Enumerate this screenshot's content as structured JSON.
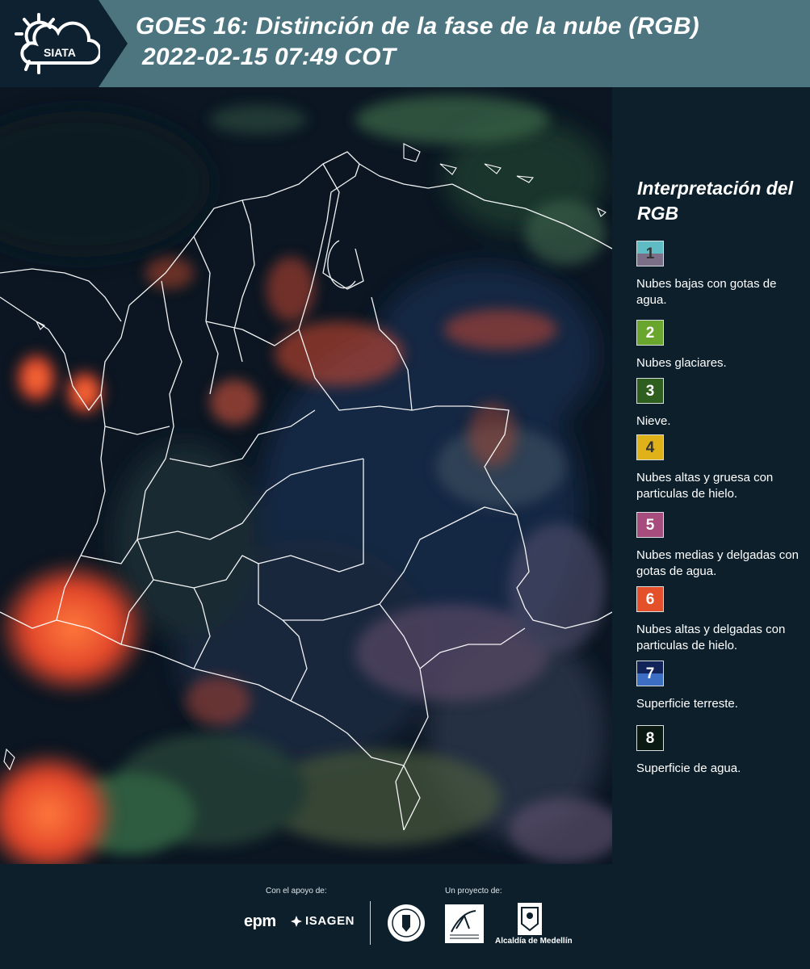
{
  "header": {
    "logo_text": "SIATA",
    "title_line1": "GOES 16: Distinción de la fase de la nube (RGB)",
    "title_line2": "2022-02-15 07:49 COT",
    "bg_color": "#4d7580"
  },
  "legend": {
    "title": "Interpretación del RGB",
    "items": [
      {
        "number": "1",
        "label": "Nubes bajas con gotas de agua.",
        "colors": [
          "#5fbcc4",
          "#7a6f86"
        ],
        "num_color": "#333333"
      },
      {
        "number": "2",
        "label": "Nubes glaciares.",
        "colors": [
          "#6aa62e"
        ],
        "num_color": "#ffffff"
      },
      {
        "number": "3",
        "label": "Nieve.",
        "colors": [
          "#2f5f1e"
        ],
        "num_color": "#ffffff"
      },
      {
        "number": "4",
        "label": "Nubes altas y gruesa con particulas de hielo.",
        "colors": [
          "#e0b21a"
        ],
        "num_color": "#333333"
      },
      {
        "number": "5",
        "label": "Nubes medias y delgadas con gotas de agua.",
        "colors": [
          "#a64d7e"
        ],
        "num_color": "#ffffff"
      },
      {
        "number": "6",
        "label": "Nubes altas y delgadas con particulas de hielo.",
        "colors": [
          "#e4502a"
        ],
        "num_color": "#ffffff"
      },
      {
        "number": "7",
        "label": "Superficie terreste.",
        "colors": [
          "#12235a",
          "#3c6fc4"
        ],
        "num_color": "#ffffff"
      },
      {
        "number": "8",
        "label": "Superficie de agua.",
        "colors": [
          "#0a1a12"
        ],
        "num_color": "#ffffff"
      }
    ]
  },
  "footer": {
    "support_label": "Con el apoyo de:",
    "project_label": "Un proyecto de:",
    "sponsors": [
      "epm",
      "ISAGEN"
    ],
    "partners": [
      "Alcaldía de Medellín"
    ]
  }
}
